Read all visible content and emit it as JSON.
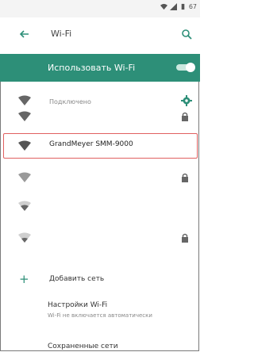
{
  "status_bar": {
    "battery_text": "67"
  },
  "app_bar": {
    "title": "Wi-Fi"
  },
  "wifi_toggle": {
    "label": "Использовать Wi-Fi",
    "enabled": true
  },
  "networks": [
    {
      "name": "",
      "status": "Подключено",
      "locked": false,
      "has_settings": true
    },
    {
      "name": "",
      "status": "",
      "locked": true,
      "has_settings": false
    },
    {
      "name": "GrandMeyer SMM-9000",
      "status": "",
      "locked": false,
      "has_settings": false,
      "selected": true
    },
    {
      "name": "",
      "status": "",
      "locked": true,
      "has_settings": false
    },
    {
      "name": "",
      "status": "",
      "locked": false,
      "has_settings": false
    },
    {
      "name": "",
      "status": "",
      "locked": true,
      "has_settings": false
    }
  ],
  "add_network": {
    "label": "Добавить сеть"
  },
  "wifi_settings": {
    "title": "Настройки Wi-Fi",
    "subtitle": "Wi-Fi не включается автоматически"
  },
  "saved_networks": {
    "label": "Сохраненные сети"
  },
  "colors": {
    "accent": "#2d8f78",
    "selection_border": "#e06060"
  }
}
